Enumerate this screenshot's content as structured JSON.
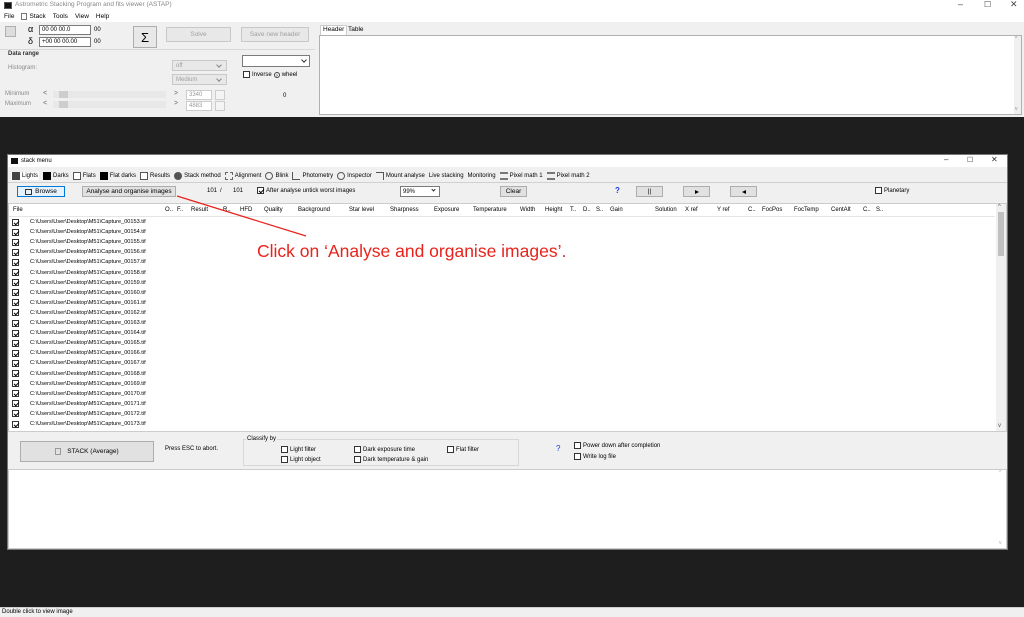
{
  "title": "Astrometric Stacking Program and fits viewer (ASTAP)",
  "menu": [
    "File",
    "Stack",
    "Tools",
    "View",
    "Help"
  ],
  "coords": {
    "alpha_symbol": "α",
    "delta_symbol": "δ",
    "ra": "00 00 00.0",
    "dec": "+00 00 00.00",
    "ra_suffix": "00",
    "dec_suffix": "00"
  },
  "sigma": "Σ",
  "solve_label": "Solve",
  "save_header_label": "Save new header",
  "header_tabs": [
    "Header",
    "Table"
  ],
  "data_range": {
    "title": "Data range",
    "histogram": "Histogram:",
    "off": "off",
    "medium": "Medium",
    "minimum": "Minimum",
    "maximum": "Maximum",
    "min_value": "3340",
    "max_value": "4883",
    "zero": "0",
    "inverse": "Inverse",
    "wheel": "wheel",
    "min_pos": 0.06,
    "max_pos": 0.06
  },
  "stack_window": {
    "title": "stack menu",
    "tabs": [
      "Lights",
      "Darks",
      "Flats",
      "Flat darks",
      "Results",
      "Stack method",
      "Alignment",
      "Blink",
      "Photometry",
      "Inspector",
      "Mount analyse",
      "Live stacking",
      "Monitoring",
      "Pixel math 1",
      "Pixel math 2"
    ],
    "browse": "Browse",
    "analyse": "Analyse and organise images",
    "count_a": "101",
    "slash": "/",
    "count_b": "101",
    "untick": "After analyse untick worst images",
    "percent": "99%",
    "clear": "Clear",
    "help": "?",
    "pause": "||",
    "planetary": "Planetary",
    "columns": [
      "File",
      "O..",
      "F..",
      "Result",
      "R..",
      "HFD",
      "Quality",
      "Background",
      "Star level",
      "Sharpness",
      "Exposure",
      "Temperature",
      "Width",
      "Height",
      "T..",
      "D..",
      "S..",
      "Gain",
      "Solution",
      "X ref",
      "Y ref",
      "C..",
      "FocPos",
      "FocTemp",
      "CentAlt",
      "C..",
      "S.."
    ],
    "files": [
      "C:\\Users\\User\\Desktop\\M51\\Capture_00153.tif",
      "C:\\Users\\User\\Desktop\\M51\\Capture_00154.tif",
      "C:\\Users\\User\\Desktop\\M51\\Capture_00155.tif",
      "C:\\Users\\User\\Desktop\\M51\\Capture_00156.tif",
      "C:\\Users\\User\\Desktop\\M51\\Capture_00157.tif",
      "C:\\Users\\User\\Desktop\\M51\\Capture_00158.tif",
      "C:\\Users\\User\\Desktop\\M51\\Capture_00159.tif",
      "C:\\Users\\User\\Desktop\\M51\\Capture_00160.tif",
      "C:\\Users\\User\\Desktop\\M51\\Capture_00161.tif",
      "C:\\Users\\User\\Desktop\\M51\\Capture_00162.tif",
      "C:\\Users\\User\\Desktop\\M51\\Capture_00163.tif",
      "C:\\Users\\User\\Desktop\\M51\\Capture_00164.tif",
      "C:\\Users\\User\\Desktop\\M51\\Capture_00165.tif",
      "C:\\Users\\User\\Desktop\\M51\\Capture_00166.tif",
      "C:\\Users\\User\\Desktop\\M51\\Capture_00167.tif",
      "C:\\Users\\User\\Desktop\\M51\\Capture_00168.tif",
      "C:\\Users\\User\\Desktop\\M51\\Capture_00169.tif",
      "C:\\Users\\User\\Desktop\\M51\\Capture_00170.tif",
      "C:\\Users\\User\\Desktop\\M51\\Capture_00171.tif",
      "C:\\Users\\User\\Desktop\\M51\\Capture_00172.tif",
      "C:\\Users\\User\\Desktop\\M51\\Capture_00173.tif"
    ],
    "stack_button": "STACK  (Average)",
    "press_esc": "Press ESC to abort.",
    "classify_by": "Classify by",
    "light_filter": "Light filter",
    "light_object": "Light object",
    "dark_exposure": "Dark exposure time",
    "dark_temp": "Dark temperature & gain",
    "flat_filter": "Flat filter",
    "power_down": "Power down after completion",
    "write_log": "Write log file"
  },
  "annotation": "Click on ‘Analyse and organise images’.",
  "annotation_color": "#e8231c",
  "status_bar": "Double click to view image"
}
